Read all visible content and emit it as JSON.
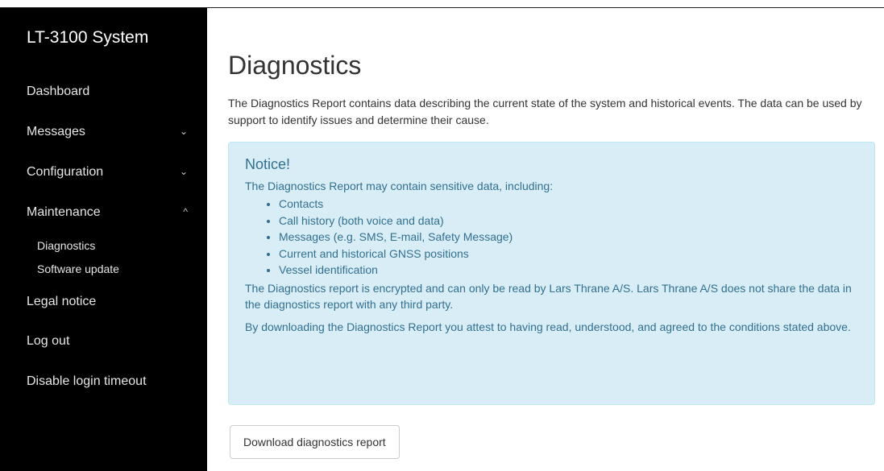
{
  "sidebar": {
    "brand": "LT-3100 System",
    "items": [
      {
        "label": "Dashboard",
        "chevron": ""
      },
      {
        "label": "Messages",
        "chevron": "⌄"
      },
      {
        "label": "Configuration",
        "chevron": "⌄"
      },
      {
        "label": "Maintenance",
        "chevron": "^"
      }
    ],
    "subitems": [
      "Diagnostics",
      "Software update"
    ],
    "bottom_items": [
      "Legal notice",
      "Log out",
      "Disable login timeout"
    ]
  },
  "main": {
    "title": "Diagnostics",
    "intro": "The Diagnostics Report contains data describing the current state of the system and historical events. The data can be used by support to identify issues and determine their cause.",
    "notice": {
      "title": "Notice!",
      "lead": "The Diagnostics Report may contain sensitive data, including:",
      "list": [
        "Contacts",
        "Call history (both voice and data)",
        "Messages (e.g. SMS, E-mail, Safety Message)",
        "Current and historical GNSS positions",
        "Vessel identification"
      ],
      "p2": "The Diagnostics report is encrypted and can only be read by Lars Thrane A/S. Lars Thrane A/S does not share the data in the diagnostics report with any third party.",
      "p3": "By downloading the Diagnostics Report you attest to having read, understood, and agreed to the conditions stated above."
    },
    "download_label": "Download diagnostics report"
  },
  "colors": {
    "sidebar_bg": "#000000",
    "notice_bg": "#d9edf7",
    "notice_text": "#31708f"
  }
}
